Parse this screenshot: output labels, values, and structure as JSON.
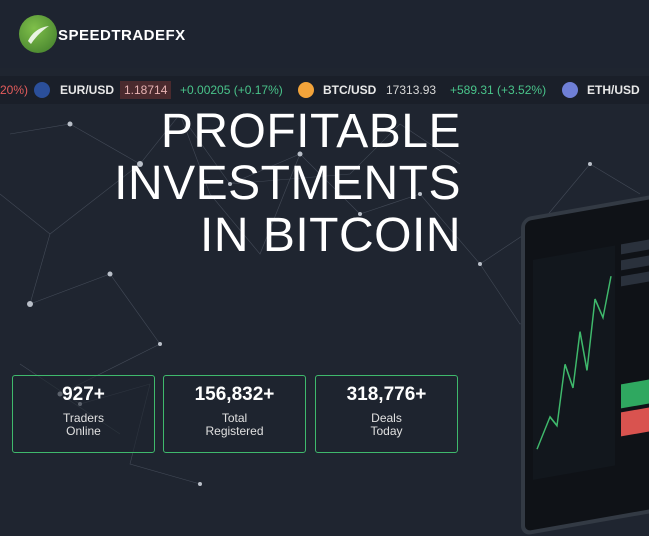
{
  "brand": {
    "name": "SPEEDTRADEFX"
  },
  "ticker": {
    "leading_change": "20%)",
    "items": [
      {
        "pair": "EUR/USD",
        "price": "1.18714",
        "change": "+0.00205 (+0.17%)"
      },
      {
        "pair": "BTC/USD",
        "price": "17313.93",
        "change": "+589.31 (+3.52%)"
      },
      {
        "pair": "ETH/USD"
      }
    ]
  },
  "hero": {
    "title_line1": "PROFITABLE",
    "title_line2": "INVESTMENTS",
    "title_line3": "IN BITCOIN"
  },
  "stats": [
    {
      "value": "927+",
      "label1": "Traders",
      "label2": "Online"
    },
    {
      "value": "156,832+",
      "label1": "Total",
      "label2": "Registered"
    },
    {
      "value": "318,776+",
      "label1": "Deals",
      "label2": "Today"
    }
  ],
  "colors": {
    "accent_green": "#3fb96c",
    "up": "#49c38a",
    "down": "#e35c5c"
  }
}
